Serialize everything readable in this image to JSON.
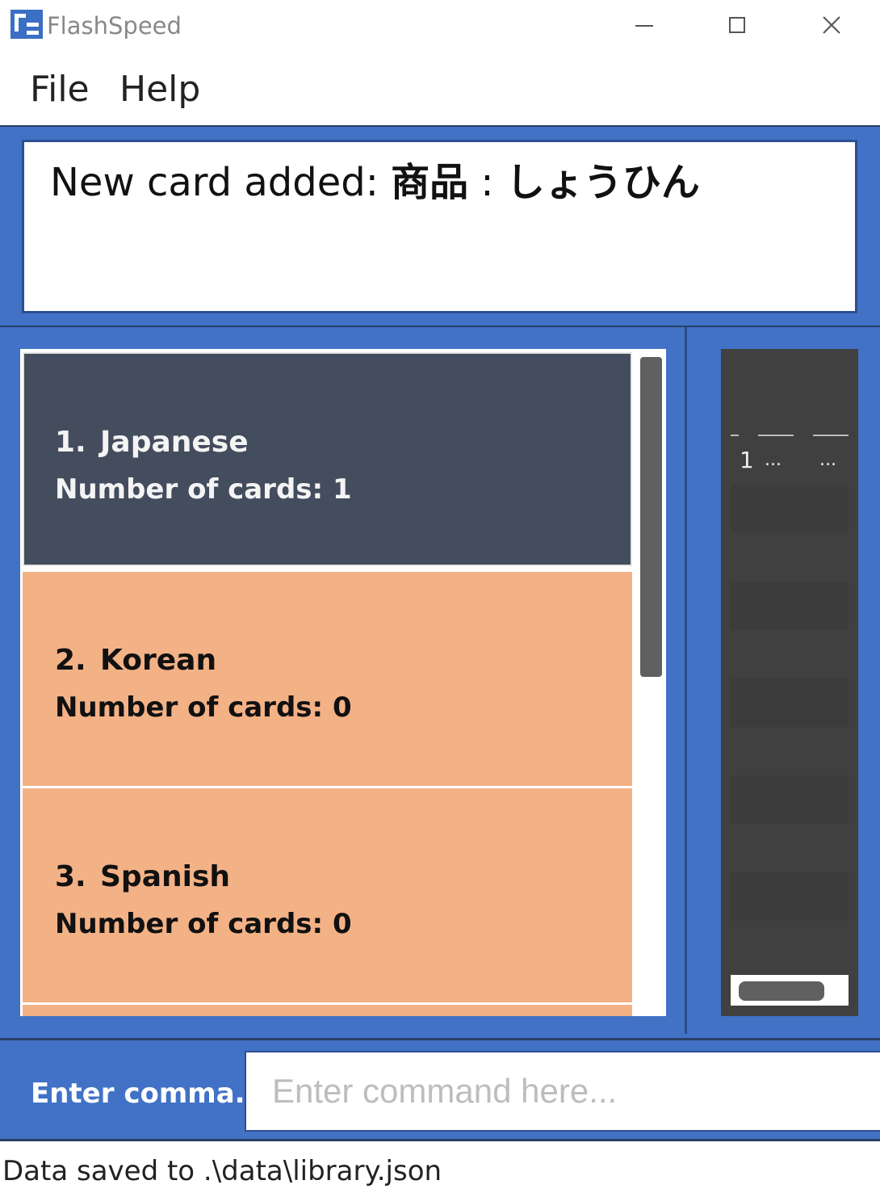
{
  "window": {
    "title": "FlashSpeed",
    "controls": {
      "minimize_icon": "minimize-icon",
      "maximize_icon": "maximize-icon",
      "close_icon": "close-icon"
    }
  },
  "menu": {
    "items": [
      {
        "label": "File"
      },
      {
        "label": "Help"
      }
    ]
  },
  "result": {
    "prefix": "New card added: ",
    "question": "商品",
    "separator": " : ",
    "answer": "しょうひん"
  },
  "decks": [
    {
      "index": "1.",
      "name": "Japanese",
      "count_text": "Number of cards: 1"
    },
    {
      "index": "2.",
      "name": "Korean",
      "count_text": "Number of cards: 0"
    },
    {
      "index": "3.",
      "name": "Spanish",
      "count_text": "Number of cards: 0"
    }
  ],
  "card_table": {
    "row": {
      "index": "1",
      "col2": "...",
      "col3": "..."
    }
  },
  "command": {
    "label": "Enter comma...",
    "value": "",
    "placeholder": "Enter command here..."
  },
  "status": {
    "text": "Data saved to .\\data\\library.json"
  },
  "colors": {
    "accent": "#4172c6",
    "selected_deck": "#434d5e",
    "deck": "#f3b186",
    "side_panel": "#404040"
  }
}
